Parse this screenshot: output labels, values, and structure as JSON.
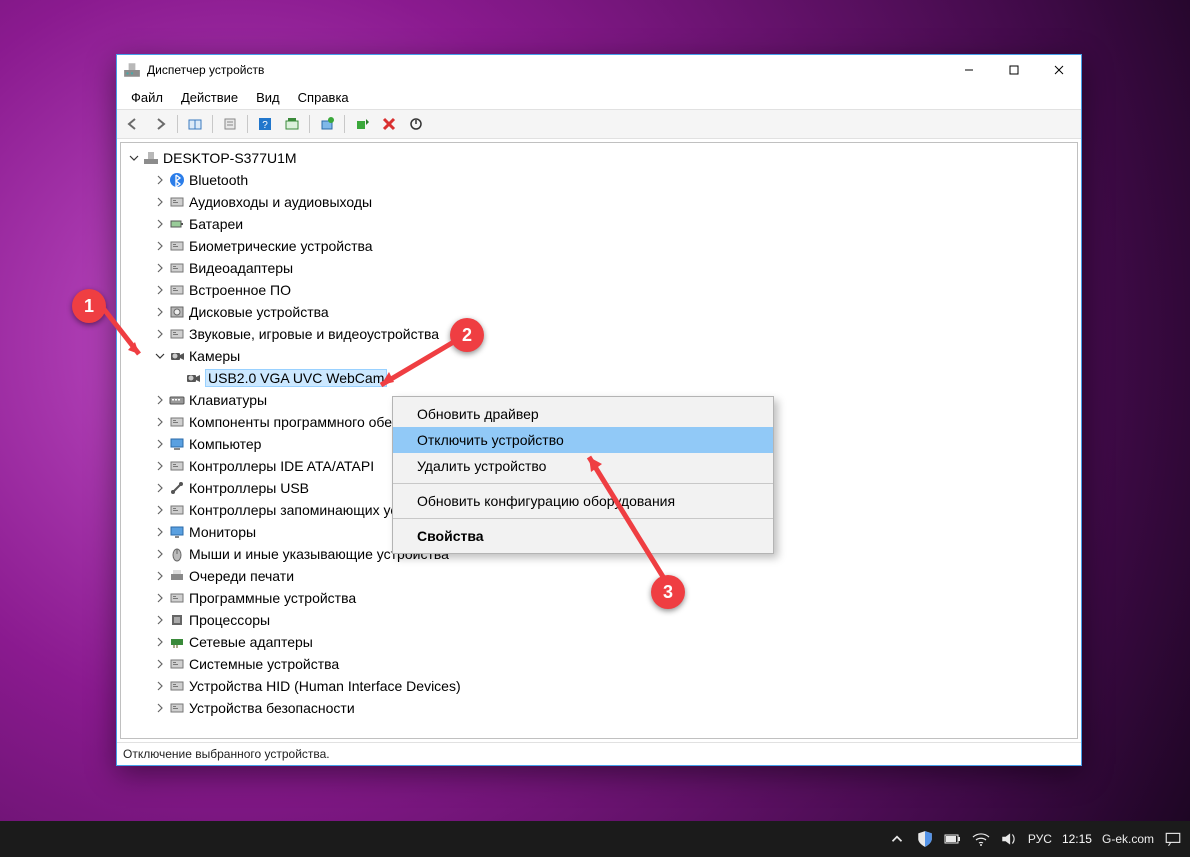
{
  "window": {
    "title": "Диспетчер устройств",
    "menubar": {
      "items": [
        "Файл",
        "Действие",
        "Вид",
        "Справка"
      ]
    },
    "statusbar": "Отключение выбранного устройства."
  },
  "tree": {
    "root": "DESKTOP-S377U1M",
    "categories": [
      "Bluetooth",
      "Аудиовходы и аудиовыходы",
      "Батареи",
      "Биометрические устройства",
      "Видеоадаптеры",
      "Встроенное ПО",
      "Дисковые устройства",
      "Звуковые, игровые и видеоустройства",
      "Камеры",
      "Клавиатуры",
      "Компоненты программного обеспечения",
      "Компьютер",
      "Контроллеры IDE ATA/ATAPI",
      "Контроллеры USB",
      "Контроллеры запоминающих устройств",
      "Мониторы",
      "Мыши и иные указывающие устройства",
      "Очереди печати",
      "Программные устройства",
      "Процессоры",
      "Сетевые адаптеры",
      "Системные устройства",
      "Устройства HID (Human Interface Devices)",
      "Устройства безопасности"
    ],
    "camera_child": "USB2.0 VGA UVC WebCam"
  },
  "context_menu": {
    "items": [
      {
        "label": "Обновить драйвер",
        "type": "item"
      },
      {
        "label": "Отключить устройство",
        "type": "item",
        "hovered": true
      },
      {
        "label": "Удалить устройство",
        "type": "item"
      },
      {
        "type": "sep"
      },
      {
        "label": "Обновить конфигурацию оборудования",
        "type": "item"
      },
      {
        "type": "sep"
      },
      {
        "label": "Свойства",
        "type": "item",
        "bold": true
      }
    ]
  },
  "markers": {
    "m1": "1",
    "m2": "2",
    "m3": "3"
  },
  "taskbar": {
    "lang": "РУС",
    "time": "12:15",
    "site": "G-ek.com"
  }
}
